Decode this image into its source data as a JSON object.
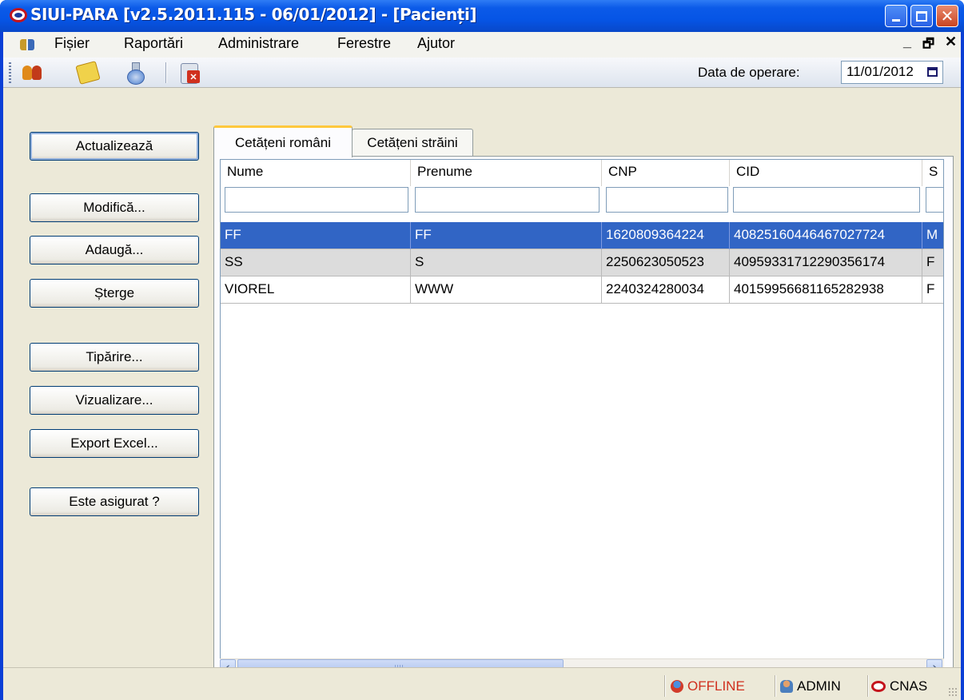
{
  "window": {
    "title": "SIUI-PARA [v2.5.2011.115 - 06/01/2012] - [Pacienți]",
    "controls": [
      "minimize",
      "maximize",
      "close"
    ]
  },
  "menu": {
    "items": [
      {
        "label": "Fișier"
      },
      {
        "label": "Raportări"
      },
      {
        "label": "Administrare"
      },
      {
        "label": "Ferestre"
      },
      {
        "label": "Ajutor"
      }
    ],
    "mdi_controls": {
      "minimize": "_",
      "restore": "🗗",
      "close": "✕"
    }
  },
  "toolbar": {
    "tools": [
      "people-icon",
      "notes-icon",
      "flask-icon",
      "exit-icon"
    ],
    "date_label": "Data de operare:",
    "date_value": "11/01/2012"
  },
  "actions": [
    {
      "label": "Actualizează"
    },
    {
      "label": "Modifică..."
    },
    {
      "label": "Adaugă..."
    },
    {
      "label": "Șterge"
    },
    {
      "label": "Tipărire..."
    },
    {
      "label": "Vizualizare..."
    },
    {
      "label": "Export Excel..."
    },
    {
      "label": "Este asigurat ?"
    }
  ],
  "tabs": [
    {
      "label": "Cetățeni români",
      "active": true
    },
    {
      "label": "Cetățeni străini",
      "active": false
    }
  ],
  "table": {
    "columns": [
      "Nume",
      "Prenume",
      "CNP",
      "CID",
      "S"
    ],
    "rows": [
      [
        "FF",
        "FF",
        "1620809364224",
        "40825160446467027724",
        "M"
      ],
      [
        "SS",
        "S",
        "2250623050523",
        "40959331712290356174",
        "F"
      ],
      [
        "VIOREL",
        "WWW",
        "2240324280034",
        "40159956681165282938",
        "F"
      ]
    ],
    "selected_row": 0
  },
  "status": {
    "connection": "OFFLINE",
    "user": "ADMIN",
    "org": "CNAS"
  },
  "colors": {
    "titlebar": "#0655e6",
    "selection": "#3165c5",
    "offline": "#d0301e",
    "tab_highlight": "#ffc83c"
  }
}
